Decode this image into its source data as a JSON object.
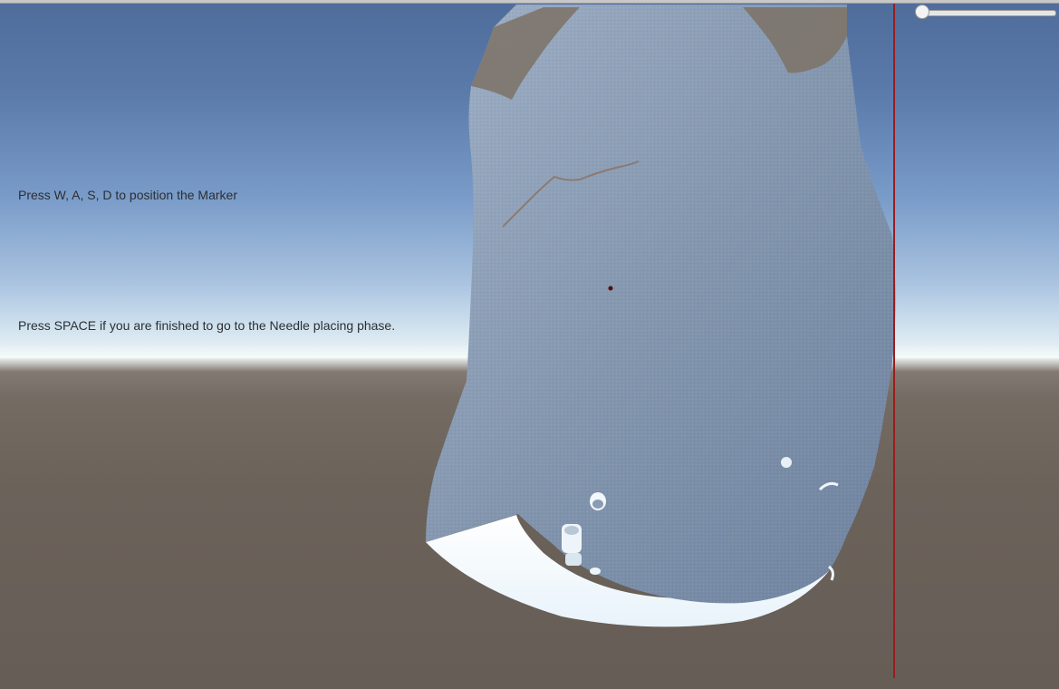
{
  "instructions": {
    "line1": "Press W, A, S, D to position the Marker",
    "line2": "Press SPACE if you are finished to go to the Needle placing phase."
  },
  "slider": {
    "value": 0
  },
  "colors": {
    "sky_top": "#4f6c9a",
    "horizon": "#f3f7f6",
    "ground": "#6b625a",
    "model": "#8ea0b8",
    "model_bright": "#eef6fb",
    "marker": "#5a0a0a",
    "red_line": "#9a1d1d"
  }
}
